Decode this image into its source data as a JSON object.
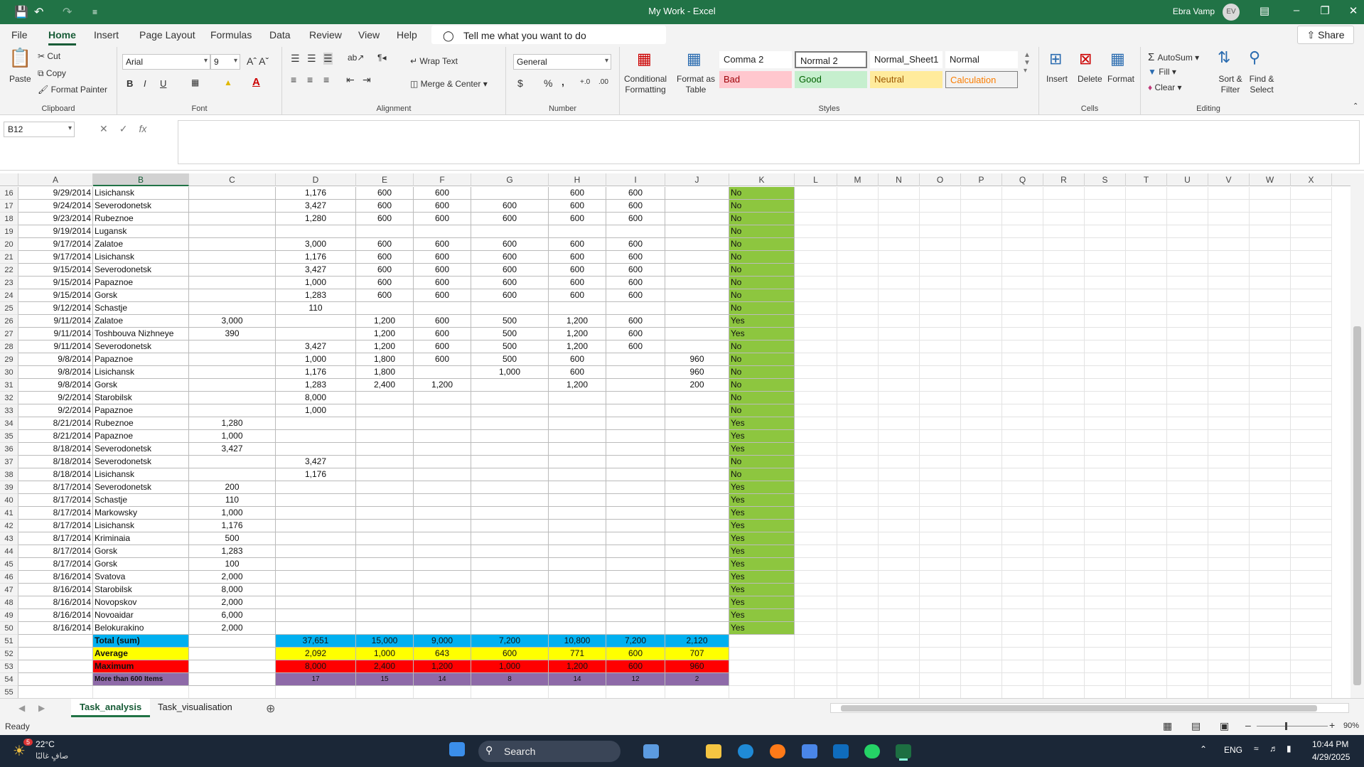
{
  "window": {
    "title": "My Work  -  Excel",
    "user": "Ebra Vamp",
    "avatar": "EV"
  },
  "tabs": [
    "File",
    "Home",
    "Insert",
    "Page Layout",
    "Formulas",
    "Data",
    "Review",
    "View",
    "Help"
  ],
  "active_tab": "Home",
  "tell_me": "Tell me what you want to do",
  "share": "Share",
  "clipboard": {
    "paste": "Paste",
    "cut": "Cut",
    "copy": "Copy",
    "format_painter": "Format Painter",
    "label": "Clipboard"
  },
  "font": {
    "name": "Arial",
    "size": "9",
    "bold": "B",
    "italic": "I",
    "underline": "U",
    "color_glyph": "A",
    "label": "Font"
  },
  "alignment": {
    "wrap": "Wrap Text",
    "merge": "Merge & Center",
    "label": "Alignment"
  },
  "number": {
    "format": "General",
    "currency": "$",
    "percent": "%",
    "comma": ",",
    "inc_dec": "+.0",
    "dec_dec": ".00",
    "label": "Number"
  },
  "styles_group": {
    "conditional": "Conditional Formatting",
    "format_table": "Format as Table",
    "label": "Styles",
    "cells": [
      {
        "name": "Comma 2"
      },
      {
        "name": "Normal 2"
      },
      {
        "name": "Normal_Sheet1"
      },
      {
        "name": "Normal"
      },
      {
        "name": "Bad"
      },
      {
        "name": "Good"
      },
      {
        "name": "Neutral"
      },
      {
        "name": "Calculation"
      }
    ]
  },
  "cells_group": {
    "insert": "Insert",
    "delete": "Delete",
    "format": "Format",
    "label": "Cells"
  },
  "editing": {
    "autosum": "AutoSum",
    "fill": "Fill",
    "clear": "Clear",
    "sort": "Sort & Filter",
    "find": "Find & Select",
    "label": "Editing"
  },
  "namebox": "B12",
  "fx": "fx",
  "columns": [
    "A",
    "B",
    "C",
    "D",
    "E",
    "F",
    "G",
    "H",
    "I",
    "J",
    "K",
    "L",
    "M",
    "N",
    "O",
    "P",
    "Q",
    "R",
    "S",
    "T",
    "U",
    "V",
    "W",
    "X"
  ],
  "selected_column": "B",
  "rows": [
    [
      "16",
      "9/29/2014",
      "Lisichansk",
      "",
      "1,176",
      "600",
      "600",
      "",
      "600",
      "600",
      "",
      "No"
    ],
    [
      "17",
      "9/24/2014",
      "Severodonetsk",
      "",
      "3,427",
      "600",
      "600",
      "600",
      "600",
      "600",
      "",
      "No"
    ],
    [
      "18",
      "9/23/2014",
      "Rubeznoe",
      "",
      "1,280",
      "600",
      "600",
      "600",
      "600",
      "600",
      "",
      "No"
    ],
    [
      "19",
      "9/19/2014",
      "Lugansk",
      "",
      "",
      "",
      "",
      "",
      "",
      "",
      "",
      "No"
    ],
    [
      "20",
      "9/17/2014",
      "Zalatoe",
      "",
      "3,000",
      "600",
      "600",
      "600",
      "600",
      "600",
      "",
      "No"
    ],
    [
      "21",
      "9/17/2014",
      "Lisichansk",
      "",
      "1,176",
      "600",
      "600",
      "600",
      "600",
      "600",
      "",
      "No"
    ],
    [
      "22",
      "9/15/2014",
      "Severodonetsk",
      "",
      "3,427",
      "600",
      "600",
      "600",
      "600",
      "600",
      "",
      "No"
    ],
    [
      "23",
      "9/15/2014",
      "Papaznoe",
      "",
      "1,000",
      "600",
      "600",
      "600",
      "600",
      "600",
      "",
      "No"
    ],
    [
      "24",
      "9/15/2014",
      "Gorsk",
      "",
      "1,283",
      "600",
      "600",
      "600",
      "600",
      "600",
      "",
      "No"
    ],
    [
      "25",
      "9/12/2014",
      "Schastje",
      "",
      "110",
      "",
      "",
      "",
      "",
      "",
      "",
      "No"
    ],
    [
      "26",
      "9/11/2014",
      "Zalatoe",
      "3,000",
      "",
      "1,200",
      "600",
      "500",
      "1,200",
      "600",
      "",
      "Yes"
    ],
    [
      "27",
      "9/11/2014",
      "Toshbouva Nizhneye",
      "390",
      "",
      "1,200",
      "600",
      "500",
      "1,200",
      "600",
      "",
      "Yes"
    ],
    [
      "28",
      "9/11/2014",
      "Severodonetsk",
      "",
      "3,427",
      "1,200",
      "600",
      "500",
      "1,200",
      "600",
      "",
      "No"
    ],
    [
      "29",
      "9/8/2014",
      "Papaznoe",
      "",
      "1,000",
      "1,800",
      "600",
      "500",
      "600",
      "",
      "960",
      "No"
    ],
    [
      "30",
      "9/8/2014",
      "Lisichansk",
      "",
      "1,176",
      "1,800",
      "",
      "1,000",
      "600",
      "",
      "960",
      "No"
    ],
    [
      "31",
      "9/8/2014",
      "Gorsk",
      "",
      "1,283",
      "2,400",
      "1,200",
      "",
      "1,200",
      "",
      "200",
      "No"
    ],
    [
      "32",
      "9/2/2014",
      "Starobilsk",
      "",
      "8,000",
      "",
      "",
      "",
      "",
      "",
      "",
      "No"
    ],
    [
      "33",
      "9/2/2014",
      "Papaznoe",
      "",
      "1,000",
      "",
      "",
      "",
      "",
      "",
      "",
      "No"
    ],
    [
      "34",
      "8/21/2014",
      "Rubeznoe",
      "1,280",
      "",
      "",
      "",
      "",
      "",
      "",
      "",
      "Yes"
    ],
    [
      "35",
      "8/21/2014",
      "Papaznoe",
      "1,000",
      "",
      "",
      "",
      "",
      "",
      "",
      "",
      "Yes"
    ],
    [
      "36",
      "8/18/2014",
      "Severodonetsk",
      "3,427",
      "",
      "",
      "",
      "",
      "",
      "",
      "",
      "Yes"
    ],
    [
      "37",
      "8/18/2014",
      "Severodonetsk",
      "",
      "3,427",
      "",
      "",
      "",
      "",
      "",
      "",
      "No"
    ],
    [
      "38",
      "8/18/2014",
      "Lisichansk",
      "",
      "1,176",
      "",
      "",
      "",
      "",
      "",
      "",
      "No"
    ],
    [
      "39",
      "8/17/2014",
      "Severodonetsk",
      "200",
      "",
      "",
      "",
      "",
      "",
      "",
      "",
      "Yes"
    ],
    [
      "40",
      "8/17/2014",
      "Schastje",
      "110",
      "",
      "",
      "",
      "",
      "",
      "",
      "",
      "Yes"
    ],
    [
      "41",
      "8/17/2014",
      "Markowsky",
      "1,000",
      "",
      "",
      "",
      "",
      "",
      "",
      "",
      "Yes"
    ],
    [
      "42",
      "8/17/2014",
      "Lisichansk",
      "1,176",
      "",
      "",
      "",
      "",
      "",
      "",
      "",
      "Yes"
    ],
    [
      "43",
      "8/17/2014",
      "Kriminaia",
      "500",
      "",
      "",
      "",
      "",
      "",
      "",
      "",
      "Yes"
    ],
    [
      "44",
      "8/17/2014",
      "Gorsk",
      "1,283",
      "",
      "",
      "",
      "",
      "",
      "",
      "",
      "Yes"
    ],
    [
      "45",
      "8/17/2014",
      "Gorsk",
      "100",
      "",
      "",
      "",
      "",
      "",
      "",
      "",
      "Yes"
    ],
    [
      "46",
      "8/16/2014",
      "Svatova",
      "2,000",
      "",
      "",
      "",
      "",
      "",
      "",
      "",
      "Yes"
    ],
    [
      "47",
      "8/16/2014",
      "Starobilsk",
      "8,000",
      "",
      "",
      "",
      "",
      "",
      "",
      "",
      "Yes"
    ],
    [
      "48",
      "8/16/2014",
      "Novopskov",
      "2,000",
      "",
      "",
      "",
      "",
      "",
      "",
      "",
      "Yes"
    ],
    [
      "49",
      "8/16/2014",
      "Novoaidar",
      "6,000",
      "",
      "",
      "",
      "",
      "",
      "",
      "",
      "Yes"
    ],
    [
      "50",
      "8/16/2014",
      "Belokurakino",
      "2,000",
      "",
      "",
      "",
      "",
      "",
      "",
      "",
      "Yes"
    ]
  ],
  "summary": [
    {
      "row": "51",
      "label": "Total (sum)",
      "fill": "#00b0f0",
      "values": [
        "37,651",
        "15,000",
        "9,000",
        "7,200",
        "10,800",
        "7,200",
        "2,120"
      ]
    },
    {
      "row": "52",
      "label": "Average",
      "fill": "#ffff00",
      "values": [
        "2,092",
        "1,000",
        "643",
        "600",
        "771",
        "600",
        "707"
      ]
    },
    {
      "row": "53",
      "label": "Maximum",
      "fill": "#ff0000",
      "values": [
        "8,000",
        "2,400",
        "1,200",
        "1,000",
        "1,200",
        "600",
        "960"
      ]
    },
    {
      "row": "54",
      "label": "More than 600 Items",
      "fill": "#8e6aa8",
      "values": [
        "17",
        "15",
        "14",
        "8",
        "14",
        "12",
        "2"
      ]
    }
  ],
  "empty_rows": [
    "55"
  ],
  "k_fill": "#8dc63f",
  "sheets": [
    "Task_analysis",
    "Task_visualisation"
  ],
  "active_sheet": "Task_analysis",
  "status": "Ready",
  "zoom": "90%",
  "taskbar": {
    "weather_temp": "22°C",
    "weather_desc": "صافٍ غالبًا",
    "weather_badge": "5",
    "search": "Search",
    "lang": "ENG",
    "time": "10:44 PM",
    "date": "4/29/2025"
  }
}
